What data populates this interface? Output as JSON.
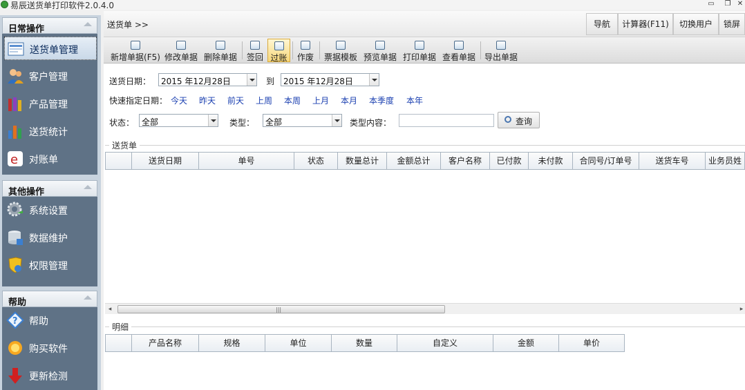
{
  "window": {
    "title": "易辰送货单打印软件2.0.4.0",
    "controls": [
      "minimize-icon",
      "restore-icon",
      "close-icon"
    ]
  },
  "sidebar": {
    "sections": [
      {
        "title": "日常操作",
        "items": [
          {
            "label": "送货单管理",
            "icon": "delivery-form-icon",
            "active": true
          },
          {
            "label": "客户管理",
            "icon": "customer-icon"
          },
          {
            "label": "产品管理",
            "icon": "product-icon"
          },
          {
            "label": "送货统计",
            "icon": "statistics-icon"
          },
          {
            "label": "对账单",
            "icon": "statement-icon"
          }
        ]
      },
      {
        "title": "其他操作",
        "items": [
          {
            "label": "系统设置",
            "icon": "gear-icon"
          },
          {
            "label": "数据维护",
            "icon": "database-icon"
          },
          {
            "label": "权限管理",
            "icon": "shield-icon"
          }
        ]
      },
      {
        "title": "帮助",
        "items": [
          {
            "label": "帮助",
            "icon": "help-icon"
          },
          {
            "label": "购买软件",
            "icon": "purchase-icon"
          },
          {
            "label": "更新检测",
            "icon": "update-icon"
          }
        ]
      }
    ]
  },
  "breadcrumb": "送货单 >>",
  "topbar": {
    "buttons": [
      "导航",
      "计算器(F11)",
      "切换用户",
      "锁屏"
    ]
  },
  "toolbar": {
    "items": [
      {
        "label": "新增单据(F5)"
      },
      {
        "label": "修改单据"
      },
      {
        "label": "删除单据"
      },
      {
        "label": "签回"
      },
      {
        "label": "过账",
        "active": true
      },
      {
        "label": "作废"
      },
      {
        "label": "票据模板"
      },
      {
        "label": "预览单据"
      },
      {
        "label": "打印单据"
      },
      {
        "label": "查看单据"
      },
      {
        "label": "导出单据"
      }
    ]
  },
  "filters": {
    "date_label": "送货日期：",
    "date_from": "2015 年12月28日",
    "to_label": "到",
    "date_to": "2015 年12月28日",
    "quick_label": "快速指定日期：",
    "quick_options": [
      "今天",
      "昨天",
      "前天",
      "上周",
      "本周",
      "上月",
      "本月",
      "本季度",
      "本年"
    ],
    "status_label": "状态：",
    "status_value": "全部",
    "type_label": "类型：",
    "type_value": "全部",
    "type_content_label": "类型内容：",
    "type_content_value": "",
    "query_label": "查询"
  },
  "orders_grid": {
    "group_title": "送货单",
    "columns": [
      "",
      "送货日期",
      "单号",
      "状态",
      "数量总计",
      "金额总计",
      "客户名称",
      "已付款",
      "未付款",
      "合同号/订单号",
      "送货车号",
      "业务员姓"
    ],
    "rows": []
  },
  "detail_grid": {
    "group_title": "明细",
    "columns": [
      "",
      "产品名称",
      "规格",
      "单位",
      "数量",
      "自定义",
      "金额",
      "单价"
    ],
    "rows": []
  },
  "colors": {
    "sidebar_bg": "#5f7286",
    "link_blue": "#1a3fb0",
    "active_tool": "#f6d77a"
  }
}
